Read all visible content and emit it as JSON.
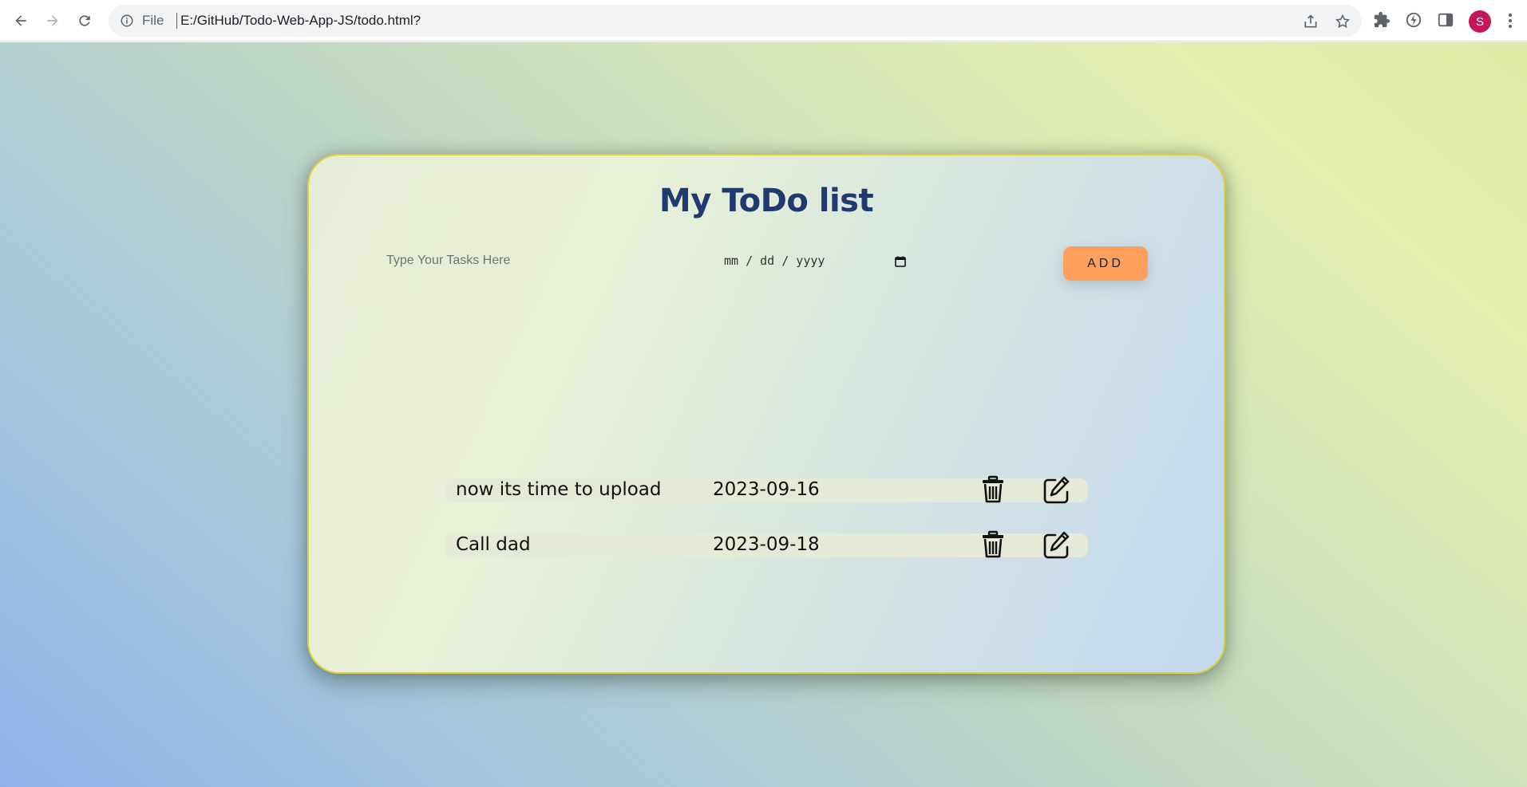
{
  "browser": {
    "scheme_label": "File",
    "url": "E:/GitHub/Todo-Web-App-JS/todo.html?",
    "profile_initial": "S",
    "profile_color": "#c2185b"
  },
  "app": {
    "title": "My ToDo list",
    "task_input": {
      "value": "",
      "placeholder": "Type Your Tasks Here"
    },
    "date_input": {
      "placeholder": "mm / dd / yyyy"
    },
    "add_label": "ADD",
    "accent_color": "#ff9f5e",
    "title_color": "#1e3a6e",
    "todos": [
      {
        "text": "now its time to upload",
        "date": "2023-09-16"
      },
      {
        "text": "Call dad",
        "date": "2023-09-18"
      }
    ]
  }
}
